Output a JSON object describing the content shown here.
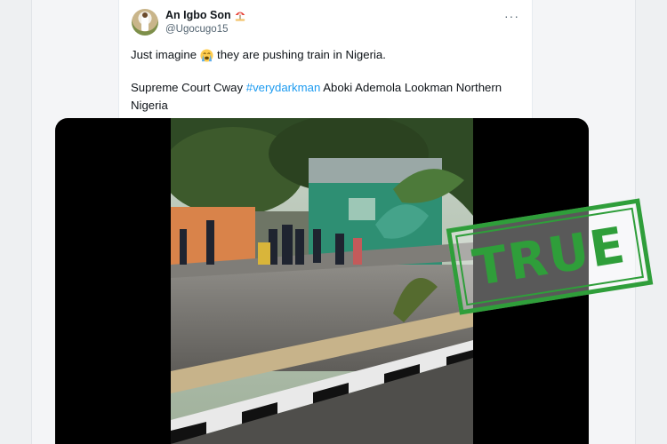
{
  "tweet": {
    "author_name": "An Igbo Son",
    "author_handle": "@Ugocugo15",
    "text_line1_before_emoji": "Just imagine",
    "text_line1_after_emoji": "they are pushing train in Nigeria.",
    "text_line2_before_hashtag": "Supreme Court Cway ",
    "hashtag": "#verydarkman",
    "text_line2_after_hashtag": " Aboki Ademola Lookman Northern Nigeria",
    "more_icon": "···"
  },
  "icons": {
    "author_badge": "umbrella-on-ground-emoji",
    "text_emoji": "loudly-crying-face-emoji",
    "more": "more-options-icon"
  },
  "stamp": {
    "label": "TRUE",
    "color": "#2f9e3a"
  },
  "colors": {
    "hashtag": "#1d9bf0",
    "text": "#0f1419",
    "secondary": "#536471"
  }
}
